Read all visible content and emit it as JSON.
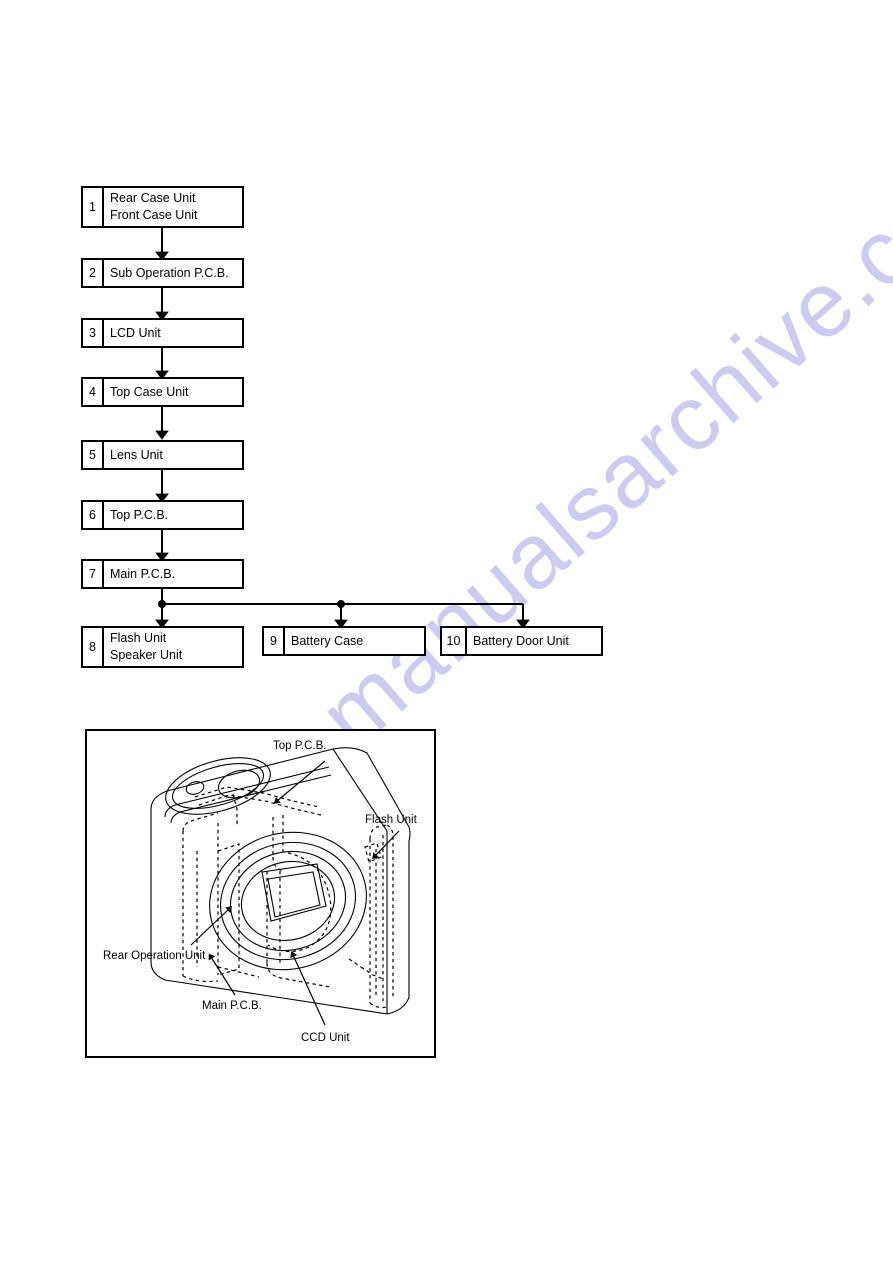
{
  "document": {
    "kind": "service-manual-disassembly-flow-chart",
    "watermark_text": "manualsarchive.com"
  },
  "flow_chart": {
    "type": "disassembly-order",
    "steps": [
      {
        "number": "1",
        "lines": [
          "Rear Case Unit",
          "Front Case Unit"
        ]
      },
      {
        "number": "2",
        "lines": [
          "Sub Operation P.C.B."
        ]
      },
      {
        "number": "3",
        "lines": [
          "LCD Unit"
        ]
      },
      {
        "number": "4",
        "lines": [
          "Top Case Unit"
        ]
      },
      {
        "number": "5",
        "lines": [
          "Lens Unit"
        ]
      },
      {
        "number": "6",
        "lines": [
          "Top P.C.B."
        ]
      },
      {
        "number": "7",
        "lines": [
          "Main P.C.B."
        ]
      },
      {
        "number": "8",
        "lines": [
          "Flash Unit",
          "Speaker Unit"
        ]
      },
      {
        "number": "9",
        "lines": [
          "Battery Case"
        ]
      },
      {
        "number": "10",
        "lines": [
          "Battery Door Unit"
        ]
      }
    ]
  },
  "illustration": {
    "title": "camera-exploded-view",
    "callouts": [
      {
        "id": "top-pcb",
        "label": "Top P.C.B."
      },
      {
        "id": "flash-unit",
        "label": "Flash Unit"
      },
      {
        "id": "rear-operation-unit",
        "label": "Rear Operation Unit"
      },
      {
        "id": "main-pcb",
        "label": "Main P.C.B."
      },
      {
        "id": "ccd-unit",
        "label": "CCD Unit"
      }
    ]
  },
  "colors": {
    "ink": "#000000",
    "paper": "#ffffff",
    "watermark": "#ccccf0"
  }
}
